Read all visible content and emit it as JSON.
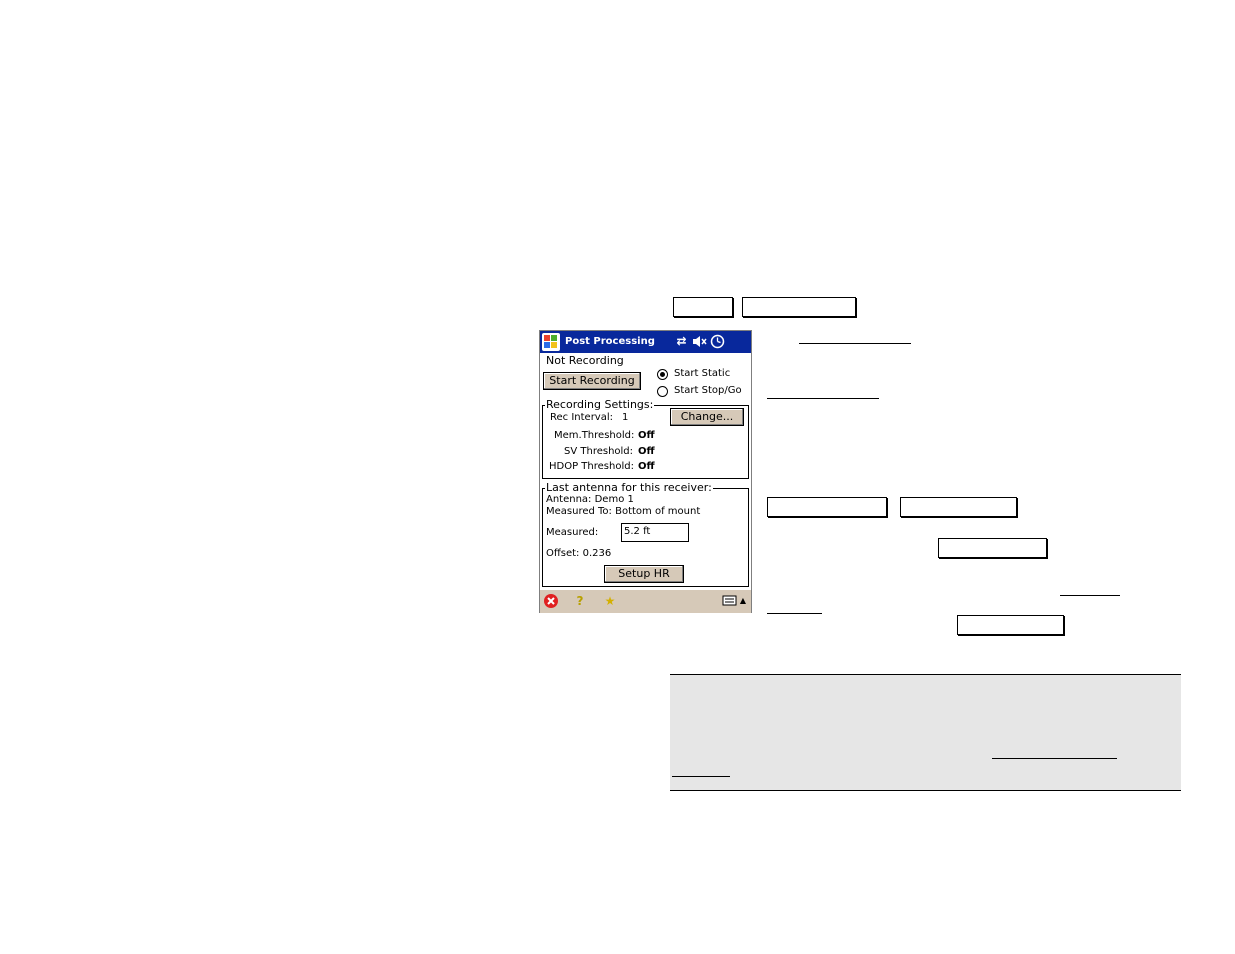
{
  "window": {
    "title": "Post Processing",
    "status_icons": [
      "sync-icon",
      "speaker-muted-icon",
      "clock-icon"
    ]
  },
  "recording": {
    "status": "Not Recording",
    "start_button": "Start Recording",
    "mode_options": [
      {
        "label": "Start Static",
        "selected": true
      },
      {
        "label": "Start Stop/Go",
        "selected": false
      }
    ]
  },
  "settings": {
    "group_label": "Recording Settings:",
    "rec_interval_label": "Rec Interval:",
    "rec_interval_value": "1",
    "change_button": "Change...",
    "mem_threshold_label": "Mem.Threshold:",
    "mem_threshold_value": "Off",
    "sv_threshold_label": "SV Threshold:",
    "sv_threshold_value": "Off",
    "hdop_threshold_label": "HDOP Threshold:",
    "hdop_threshold_value": "Off"
  },
  "antenna": {
    "group_label": "Last antenna for this receiver:",
    "antenna_line": "Antenna: Demo 1",
    "measured_to_line": "Measured To: Bottom of mount",
    "measured_label": "Measured:",
    "measured_value": "5.2 ft",
    "offset_line": "Offset: 0.236",
    "setup_button": "Setup HR"
  },
  "taskbar": {
    "icons": [
      "close-icon",
      "help-icon",
      "favorites-icon",
      "keyboard-icon"
    ]
  },
  "colors": {
    "titlebar": "#08289c",
    "button_face": "#d6c9b8",
    "note_background": "#e6e6e6"
  }
}
